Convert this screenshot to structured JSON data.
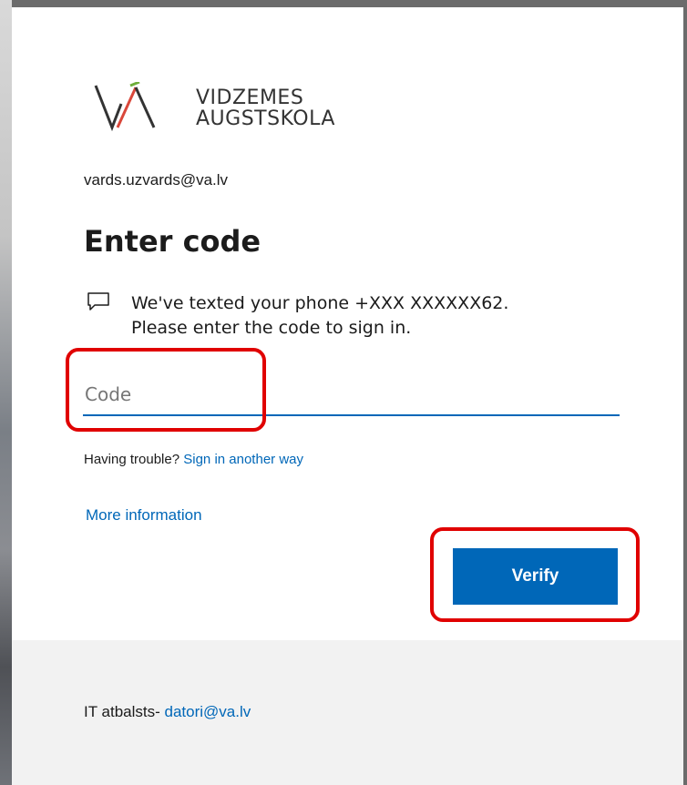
{
  "brand": {
    "line1": "VIDZEMES",
    "line2": "AUGSTSKOLA",
    "colors": {
      "dark": "#333333",
      "red": "#d9473a",
      "green": "#6fae3b"
    }
  },
  "account": "vards.uzvards@va.lv",
  "heading": "Enter code",
  "message": {
    "icon": "message-icon",
    "line1": "We've texted your phone +XXX XXXXXX62.",
    "line2": "Please enter the code to sign in."
  },
  "code_input": {
    "placeholder": "Code",
    "value": ""
  },
  "trouble": {
    "text": "Having trouble?",
    "link": "Sign in another way"
  },
  "more_info": "More information",
  "verify_label": "Verify",
  "footer": {
    "text": "IT atbalsts-",
    "link": "datori@va.lv"
  },
  "colors": {
    "accent": "#0067b8",
    "highlight": "#e00000",
    "footer_bg": "#f2f2f2"
  }
}
